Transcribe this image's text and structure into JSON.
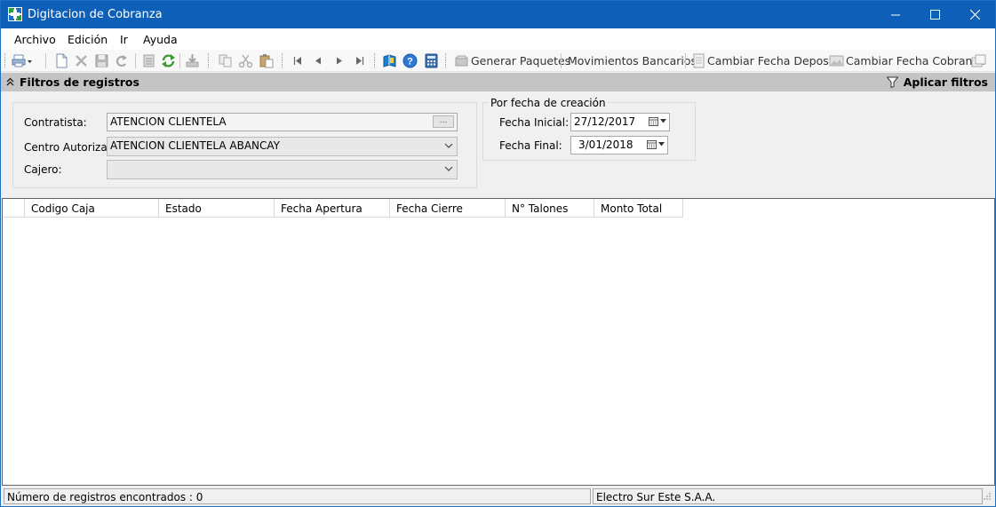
{
  "window": {
    "title": "Digitacion de Cobranza",
    "colors": {
      "titlebar": "#0d5fb8",
      "filter_header": "#c4c4c4"
    }
  },
  "menu": [
    "Archivo",
    "Edición",
    "Ir",
    "Ayuda"
  ],
  "toolbar": {
    "icons": [
      "print-icon",
      "new-document-icon",
      "delete-icon",
      "save-icon",
      "undo-icon",
      "report-icon",
      "refresh-icon",
      "export-icon",
      "copy-icon",
      "cut-icon",
      "paste-icon",
      "first-record-icon",
      "previous-record-icon",
      "next-record-icon",
      "last-record-icon",
      "book-icon",
      "help-icon",
      "calculator-icon"
    ],
    "generar_paquetes": "Generar Paquetes",
    "movimientos_bancarios": "Movimientos Bancarios",
    "cambiar_fecha_deposito": "Cambiar Fecha Deposito",
    "cambiar_fecha_cobranza": "Cambiar Fecha Cobranza"
  },
  "filters": {
    "header_title": "Filtros de registros",
    "apply_label": "Aplicar filtros",
    "contratista": {
      "label": "Contratista:",
      "value": "ATENCION CLIENTELA",
      "button": "..."
    },
    "centro": {
      "label": "Centro Autorizado:",
      "value": "ATENCION CLIENTELA ABANCAY"
    },
    "cajero": {
      "label": "Cajero:",
      "value": ""
    },
    "date_group": {
      "title": "Por fecha de creación",
      "inicial_label": "Fecha Inicial:",
      "inicial_value": "27/12/2017",
      "final_label": "Fecha Final:",
      "final_value": "3/01/2018"
    }
  },
  "grid": {
    "columns": [
      "Codigo Caja",
      "Estado",
      "Fecha Apertura",
      "Fecha Cierre",
      "N° Talones",
      "Monto Total"
    ],
    "rows": []
  },
  "status": {
    "records": "Número de registros encontrados : 0",
    "company": "Electro Sur Este S.A.A."
  }
}
